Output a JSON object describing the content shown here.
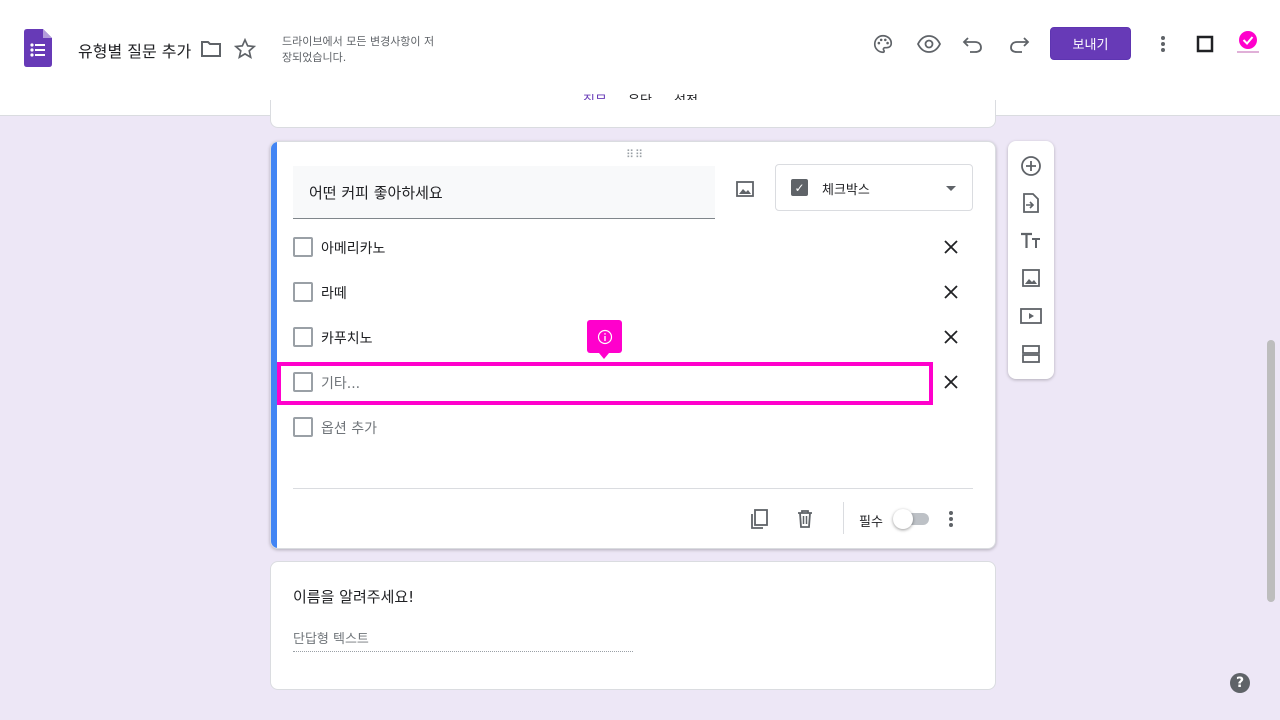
{
  "header": {
    "title": "유형별 질문 추가",
    "save_status": "드라이브에서 모든 변경사항이 저장되었습니다.",
    "send_label": "보내기",
    "icons": [
      "forms-logo-icon",
      "folder-icon",
      "star-icon",
      "palette-icon",
      "preview-eye-icon",
      "undo-icon",
      "redo-icon",
      "more-vert-icon",
      "square-icon",
      "avatar"
    ]
  },
  "tabs": [
    {
      "label": "질문",
      "active": true
    },
    {
      "label": "응답",
      "active": false
    },
    {
      "label": "설정",
      "active": false
    }
  ],
  "question": {
    "title": "어떤 커피 좋아하세요",
    "type_label": "체크박스",
    "options": [
      {
        "label": "아메리카노"
      },
      {
        "label": "라떼"
      },
      {
        "label": "카푸치노"
      },
      {
        "label": "기타..."
      }
    ],
    "add_option": "옵션 추가",
    "required_label": "필수"
  },
  "next_question": {
    "title": "이름을 알려주세요!",
    "placeholder": "단답형 텍스트"
  },
  "colors": {
    "accent": "#673ab7",
    "highlight": "#ff00cc",
    "card_bar": "#4285f4",
    "background": "#ede7f6"
  }
}
